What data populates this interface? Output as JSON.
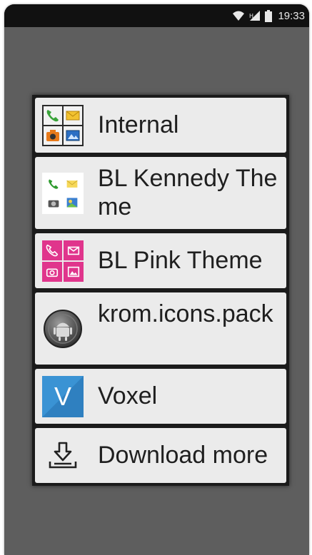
{
  "status_bar": {
    "time": "19:33",
    "icons": [
      "wifi-icon",
      "signal-icon",
      "battery-icon"
    ]
  },
  "chooser": {
    "items": [
      {
        "label": "Internal",
        "icon": "internal-theme-icon"
      },
      {
        "label": "BL Kennedy Theme",
        "icon": "kennedy-theme-icon"
      },
      {
        "label": "BL Pink Theme",
        "icon": "pink-theme-icon"
      },
      {
        "label": "krom.icons.pack",
        "icon": "android-icon"
      },
      {
        "label": "Voxel",
        "icon": "voxel-icon",
        "icon_letter": "V"
      },
      {
        "label": "Download more",
        "icon": "download-icon"
      }
    ]
  },
  "colors": {
    "background": "#5e5e5e",
    "status_bar": "#111111",
    "item_bg": "#ebebeb",
    "pink": "#e0358c",
    "voxel_blue": "#3a93d4"
  }
}
